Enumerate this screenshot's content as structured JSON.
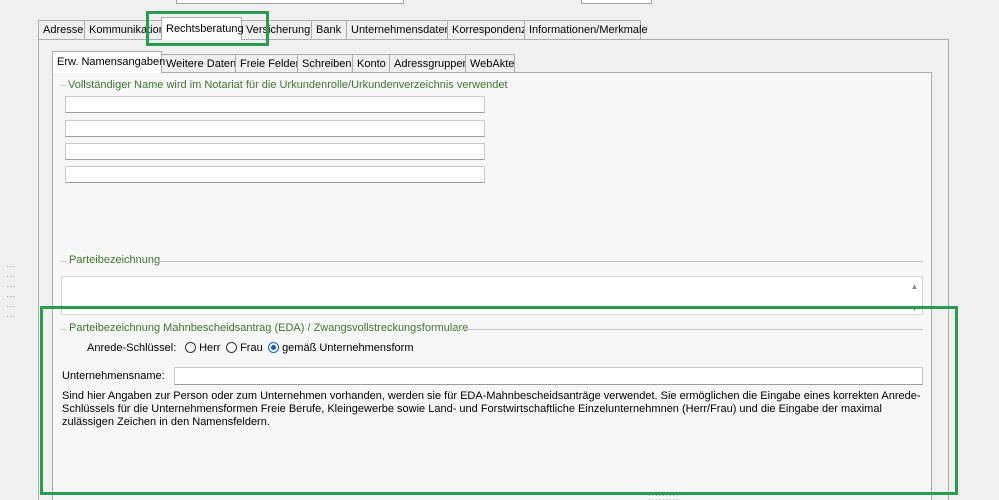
{
  "outer_tabs": [
    {
      "label": "Adresse"
    },
    {
      "label": "Kommunikation"
    },
    {
      "label": "Rechtsberatung"
    },
    {
      "label": "Versicherung"
    },
    {
      "label": "Bank"
    },
    {
      "label": "Unternehmensdaten"
    },
    {
      "label": "Korrespondenz"
    },
    {
      "label": "Informationen/Merkmale"
    }
  ],
  "inner_tabs": [
    {
      "label": "Erw. Namensangaben"
    },
    {
      "label": "Weitere Daten"
    },
    {
      "label": "Freie Felder"
    },
    {
      "label": "Schreiben"
    },
    {
      "label": "Konto"
    },
    {
      "label": "Adressgruppen"
    },
    {
      "label": "WebAkte"
    }
  ],
  "groups": {
    "full_name_legend": "Vollständiger Name wird im Notariat für die Urkundenrolle/Urkundenverzeichnis verwendet",
    "party_legend": "Parteibezeichnung",
    "eda_legend": "Parteibezeichnung Mahnbescheidsantrag (EDA) / Zwangsvollstreckungsformulare"
  },
  "salutation": {
    "label": "Anrede-Schlüssel:",
    "options": [
      {
        "label": "Herr",
        "selected": false
      },
      {
        "label": "Frau",
        "selected": false
      },
      {
        "label": "gemäß Unternehmensform",
        "selected": true
      }
    ]
  },
  "company": {
    "label": "Unternehmensname:",
    "value": ""
  },
  "info_text": "Sind hier Angaben zur Person oder zum Unternehmen vorhanden, werden sie für EDA-Mahnbescheidsanträge verwendet. Sie ermöglichen die Eingabe eines korrekten Anrede-Schlüssels für die Unternehmensformen Freie Berufe, Kleingewerbe sowie Land- und Forstwirtschaftliche Einzelunternehmnen (Herr/Frau) und die Eingabe der maximal zulässigen Zeichen in den Namensfeldern.",
  "icons": {
    "scroll_up": "scroll-up-icon",
    "scroll_down": "scroll-down-icon",
    "splitter": "grip-dots-icon"
  },
  "colors": {
    "highlight": "#22a04a",
    "legend_text": "#3a7a2a",
    "radio_checked": "#0a5fc6"
  }
}
